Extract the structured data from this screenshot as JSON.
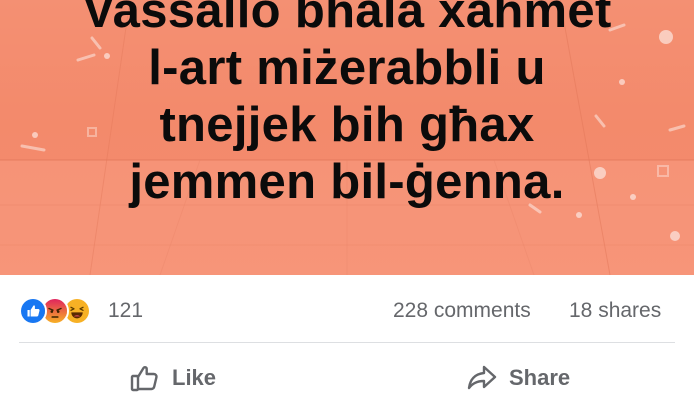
{
  "post": {
    "text_lines": [
      "Vassallo bħala xaħmet",
      "l-art miżerabbli u",
      "tnejjek bih għax",
      "jemmen bil-ġenna."
    ],
    "background_color": "#f38a6c"
  },
  "stats": {
    "reactions": [
      "like-icon",
      "angry-icon",
      "haha-icon"
    ],
    "reaction_count": "121",
    "comments": "228 comments",
    "shares": "18 shares"
  },
  "actions": {
    "like_label": "Like",
    "share_label": "Share"
  },
  "colors": {
    "meta_text": "#65676b",
    "like_blue": "#1877f2",
    "angry_orange": "#e9710f",
    "haha_yellow": "#f7b125"
  }
}
